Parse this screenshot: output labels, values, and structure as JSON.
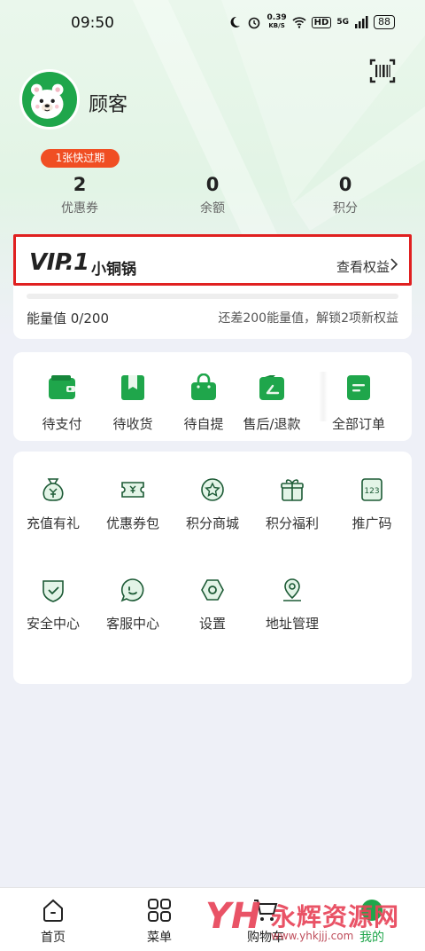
{
  "status_bar": {
    "time": "09:50",
    "net_speed_value": "0.39",
    "net_speed_unit": "KB/S",
    "hd_label": "HD",
    "signal_label": "5G",
    "battery": "88"
  },
  "header": {
    "username": "顾客",
    "scan_icon": "barcode-scan-icon",
    "avatar_icon": "bear-avatar"
  },
  "stats": {
    "coupon_tag": "1张快过期",
    "items": [
      {
        "value": "2",
        "label": "优惠券"
      },
      {
        "value": "0",
        "label": "余额"
      },
      {
        "value": "0",
        "label": "积分"
      }
    ]
  },
  "vip": {
    "level": "VIP.1",
    "name": "小铜锅",
    "link_label": "查看权益",
    "energy_label": "能量值 0/200",
    "energy_hint": "还差200能量值，解锁2项新权益",
    "progress": 0
  },
  "orders": [
    {
      "label": "待支付",
      "icon": "wallet-icon"
    },
    {
      "label": "待收货",
      "icon": "package-icon"
    },
    {
      "label": "待自提",
      "icon": "shopping-bag-icon"
    },
    {
      "label": "售后/退款",
      "icon": "refund-icon"
    },
    {
      "label": "全部订单",
      "icon": "order-list-icon"
    }
  ],
  "services": [
    {
      "label": "充值有礼",
      "icon": "money-bag-icon"
    },
    {
      "label": "优惠券包",
      "icon": "coupon-icon"
    },
    {
      "label": "积分商城",
      "icon": "star-badge-icon"
    },
    {
      "label": "积分福利",
      "icon": "gift-icon"
    },
    {
      "label": "推广码",
      "icon": "code-icon"
    },
    {
      "label": "安全中心",
      "icon": "shield-icon"
    },
    {
      "label": "客服中心",
      "icon": "chat-icon"
    },
    {
      "label": "设置",
      "icon": "settings-icon"
    },
    {
      "label": "地址管理",
      "icon": "location-icon"
    }
  ],
  "nav": [
    {
      "label": "首页",
      "icon": "home-icon"
    },
    {
      "label": "菜单",
      "icon": "grid-icon"
    },
    {
      "label": "购物车",
      "icon": "cart-icon"
    },
    {
      "label": "我的",
      "icon": "profile-icon"
    }
  ],
  "watermark": {
    "logo": "YH",
    "text": "永辉资源网",
    "url": "www.yhkjjj.com"
  },
  "colors": {
    "brand_green": "#1fa64b",
    "tag_orange": "#f04e23",
    "highlight_red": "#e02020"
  }
}
